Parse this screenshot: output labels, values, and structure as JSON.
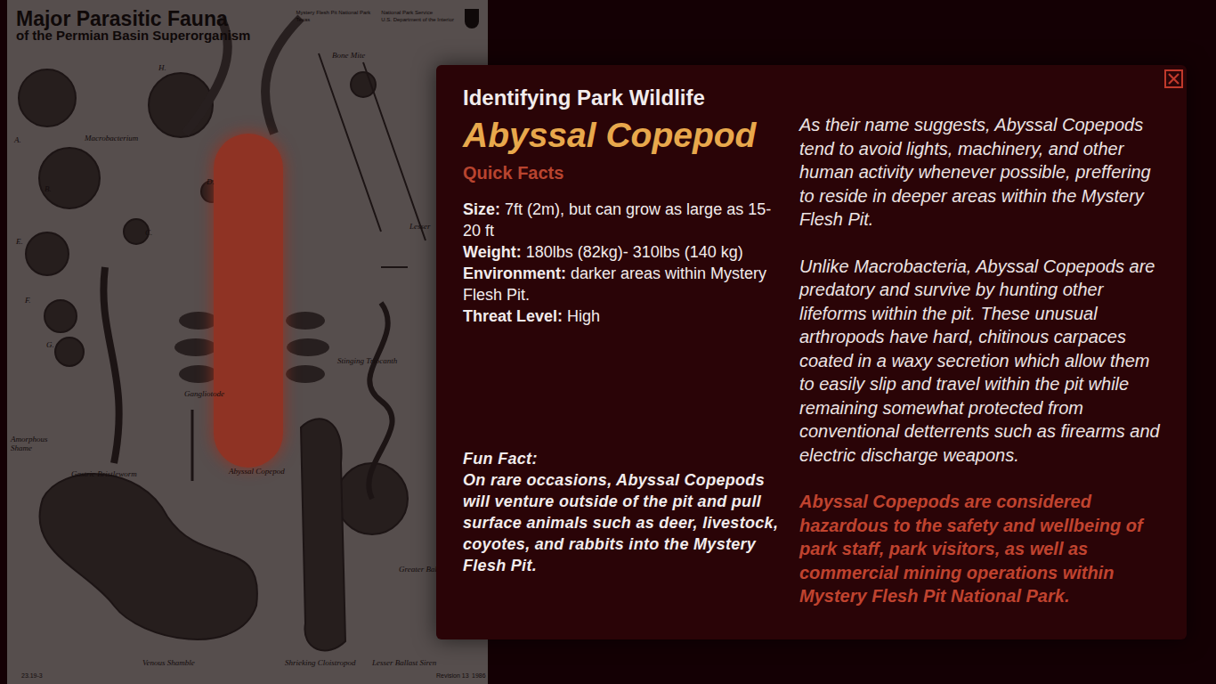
{
  "poster": {
    "title": "Major Parasitic Fauna",
    "subtitle": "of the Permian Basin Superorganism",
    "header_left": [
      "Mystery Flesh Pit National Park",
      "Texas"
    ],
    "header_right": [
      "National Park Service",
      "U.S. Department of the Interior"
    ],
    "labels": [
      {
        "text": "A.",
        "highlighted": false
      },
      {
        "text": "Macrobacterium",
        "highlighted": false
      },
      {
        "text": "B.",
        "highlighted": false
      },
      {
        "text": "C.",
        "highlighted": false
      },
      {
        "text": "D.",
        "highlighted": false
      },
      {
        "text": "E.",
        "highlighted": false
      },
      {
        "text": "F.",
        "highlighted": false
      },
      {
        "text": "G.",
        "highlighted": false
      },
      {
        "text": "H.",
        "highlighted": false
      },
      {
        "text": "Bone Mite",
        "highlighted": false
      },
      {
        "text": "Lesser",
        "highlighted": false
      },
      {
        "text": "Stinging Triocanth",
        "highlighted": false
      },
      {
        "text": "Gangliotode",
        "highlighted": false
      },
      {
        "text": "Amorphous Shame",
        "highlighted": false
      },
      {
        "text": "Abyssal Copepod",
        "highlighted": true
      },
      {
        "text": "Gastric Bristleworm",
        "highlighted": false
      },
      {
        "text": "Greater Ballast S",
        "highlighted": false
      },
      {
        "text": "Venous Shamble",
        "highlighted": false
      },
      {
        "text": "Shrieking Cloistropod",
        "highlighted": false
      },
      {
        "text": "Lesser Ballast Siren",
        "highlighted": false
      }
    ],
    "footer": [
      "23.19-3",
      "Revision 13",
      "1986"
    ]
  },
  "modal": {
    "kicker": "Identifying Park Wildlife",
    "title": "Abyssal Copepod",
    "quick_facts_heading": "Quick Facts",
    "facts": [
      {
        "label": "Size:",
        "value": "7ft (2m), but can grow as large as 15-20 ft"
      },
      {
        "label": "Weight:",
        "value": "180lbs (82kg)- 310lbs (140 kg)"
      },
      {
        "label": "Environment:",
        "value": "darker areas within Mystery Flesh Pit."
      },
      {
        "label": "Threat Level:",
        "value": "High"
      }
    ],
    "fun_fact_heading": "Fun Fact:",
    "fun_fact": "On rare occasions, Abyssal Copepods will venture outside of the pit and pull surface animals such as deer, livestock, coyotes, and rabbits into the Mystery Flesh Pit.",
    "paragraphs": [
      {
        "text": "As their name suggests, Abyssal Copepods tend to avoid lights, machinery, and other human activity whenever possible, preffering to reside in deeper areas within the Mystery Flesh Pit.",
        "warning": false
      },
      {
        "text": "Unlike Macrobacteria, Abyssal Copepods are predatory and survive by hunting other lifeforms within the pit. These unusual arthropods have hard, chitinous carpaces coated in a waxy secretion which allow them to easily slip and travel within the pit while remaining somewhat protected from conventional detterrents such as firearms and electric discharge weapons.",
        "warning": false
      },
      {
        "text": "Abyssal Copepods are considered hazardous to the safety and wellbeing of park staff, park visitors, as well as commercial mining operations within Mystery Flesh Pit National Park.",
        "warning": true
      }
    ]
  }
}
